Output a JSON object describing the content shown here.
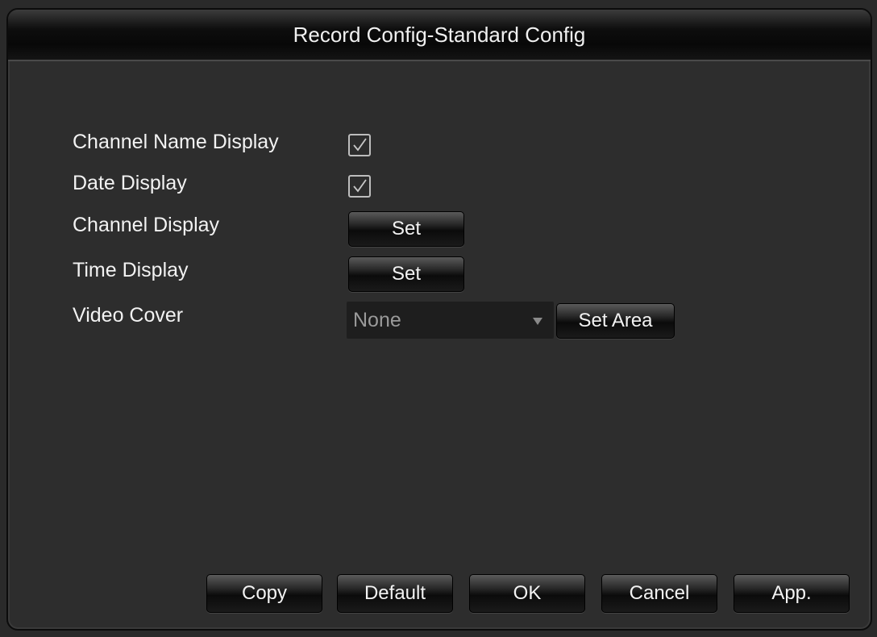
{
  "dialog": {
    "title": "Record Config-Standard Config"
  },
  "settings": {
    "channel_name_display": {
      "label": "Channel Name Display",
      "checked": true
    },
    "date_display": {
      "label": "Date Display",
      "checked": true
    },
    "channel_display": {
      "label": "Channel Display",
      "button": "Set"
    },
    "time_display": {
      "label": "Time Display",
      "button": "Set"
    },
    "video_cover": {
      "label": "Video Cover",
      "value": "None",
      "button": "Set Area"
    }
  },
  "footer": {
    "copy": "Copy",
    "default": "Default",
    "ok": "OK",
    "cancel": "Cancel",
    "apply": "App."
  },
  "icons": {
    "checkbox_mark": "check-icon",
    "dropdown": "chevron-down-icon"
  },
  "colors": {
    "background": "#2d2d2d",
    "text": "#f2f2f2",
    "muted_text": "#9a9a9a"
  }
}
